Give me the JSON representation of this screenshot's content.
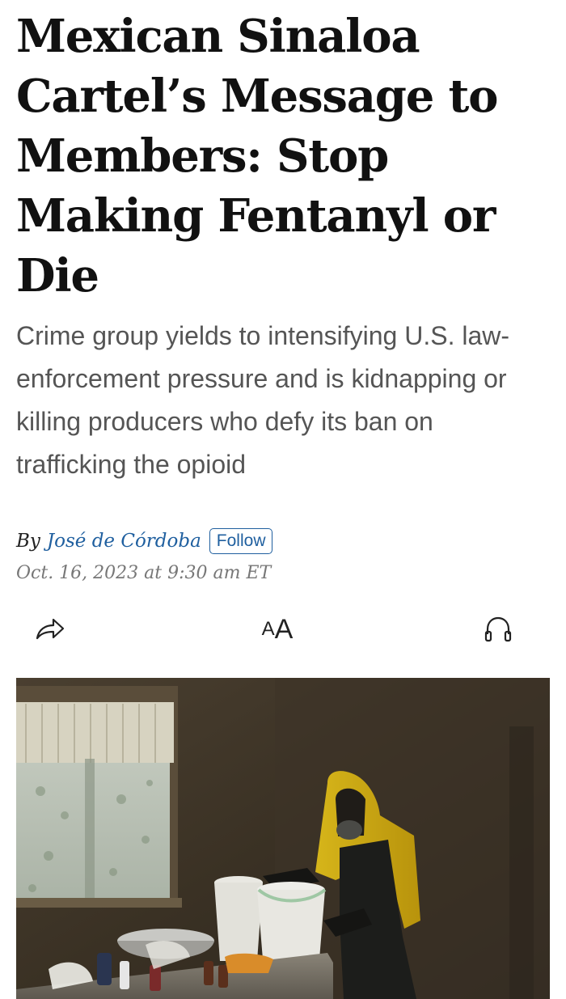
{
  "article": {
    "headline": "Mexican Sinaloa Cartel’s Message to Members: Stop Making Fentanyl or Die",
    "dek": "Crime group yields to intensifying U.S. law-enforcement pressure and is kidnapping or killing producers who defy its ban on trafficking the opioid",
    "byline_prefix": "By",
    "author": "José de Córdoba",
    "follow_label": "Follow",
    "date": "Oct. 16, 2023 at 9:30 am ET"
  },
  "toolbar": {
    "share_icon": "share-icon",
    "text_size_label_large": "A",
    "text_size_label_small": "A",
    "audio_icon": "headphones-icon"
  },
  "colors": {
    "link": "#1f5f9f",
    "headline": "#111111",
    "dek": "#555555",
    "date": "#777777"
  }
}
